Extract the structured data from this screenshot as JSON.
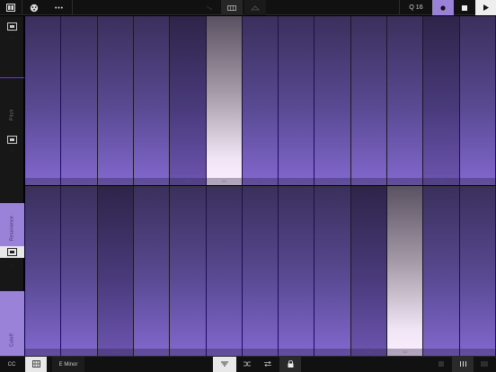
{
  "topbar": {
    "quantize_label": "Q 16",
    "record_color": "#9a82d9"
  },
  "sidebar": {
    "labels": [
      "Pitch",
      "Resonance",
      "Cutoff"
    ],
    "accent": "#9a82d9"
  },
  "keys": {
    "top_row": [
      "B1",
      "C2",
      "D2",
      "E2",
      "F#2",
      "G2",
      "A2",
      "B2",
      "C3",
      "D3",
      "E3",
      "F#3",
      "G3"
    ],
    "bottom_row": [
      "D1",
      "E1",
      "F#1",
      "G1",
      "A1",
      "B1",
      "C2",
      "D2",
      "E2",
      "F#2",
      "G2",
      "A2",
      "B2"
    ],
    "top_active_index": 5,
    "bottom_active_index": 10
  },
  "bottombar": {
    "cc_label": "CC",
    "scale_label": "E Minor"
  }
}
